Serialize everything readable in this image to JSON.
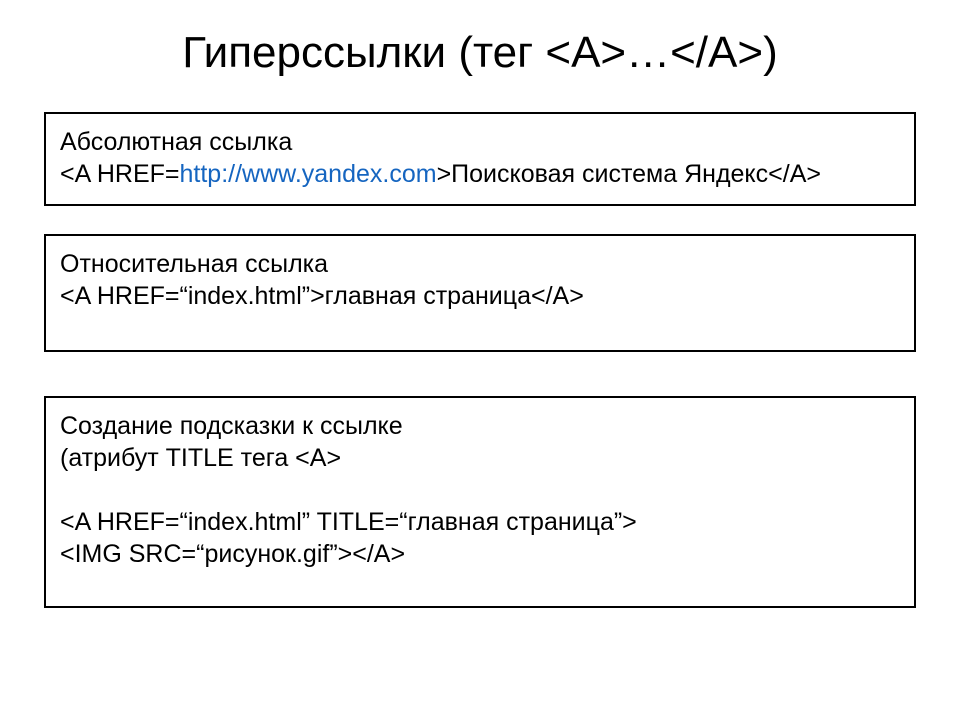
{
  "title": "Гиперссылки (тег <A>…</A>)",
  "box1": {
    "line1": "Абсолютная ссылка",
    "line2_prefix": "<A HREF=",
    "line2_url": "http://www.yandex.com",
    "line2_suffix": ">Поисковая система Яндекс</A>"
  },
  "box2": {
    "line1": "Относительная ссылка",
    "line2": "<A HREF=“index.html”>главная страница</A>"
  },
  "box3": {
    "line1": "Создание подсказки к ссылке",
    "line2": "(атрибут TITLE тега <A>",
    "line3": "<A HREF=“index.html” TITLE=“главная страница”>",
    "line4": "<IMG SRC=“рисунок.gif”></A>"
  }
}
